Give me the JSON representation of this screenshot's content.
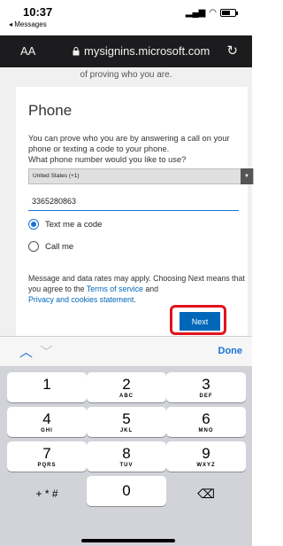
{
  "status": {
    "time": "10:37",
    "back_label": "◂ Messages"
  },
  "url_bar": {
    "aa_label": "AA",
    "url": "mysignins.microsoft.com"
  },
  "page": {
    "top_text": "of proving who you are.",
    "title": "Phone",
    "description": "You can prove who you are by answering a call on your phone or texting a code to your phone.",
    "question": "What phone number would you like to use?",
    "country": "United States (+1)",
    "phone_value": "3365280863",
    "options": [
      "Text me a code",
      "Call me"
    ],
    "notice_prefix": "Message and data rates may apply. Choosing Next means that you agree to the ",
    "terms_link": "Terms of service",
    "notice_and": " and",
    "privacy_link": "Privacy and cookies statement",
    "notice_end": ".",
    "next_label": "Next"
  },
  "keyboard": {
    "done_label": "Done",
    "keys": [
      {
        "digit": "1",
        "letters": ""
      },
      {
        "digit": "2",
        "letters": "ABC"
      },
      {
        "digit": "3",
        "letters": "DEF"
      },
      {
        "digit": "4",
        "letters": "GHI"
      },
      {
        "digit": "5",
        "letters": "JKL"
      },
      {
        "digit": "6",
        "letters": "MNO"
      },
      {
        "digit": "7",
        "letters": "PQRS"
      },
      {
        "digit": "8",
        "letters": "TUV"
      },
      {
        "digit": "9",
        "letters": "WXYZ"
      },
      {
        "digit": "+ * #",
        "letters": ""
      },
      {
        "digit": "0",
        "letters": ""
      },
      {
        "digit": "⌫",
        "letters": ""
      }
    ]
  },
  "colors": {
    "accent": "#0067b8",
    "highlight": "#e3121d"
  }
}
